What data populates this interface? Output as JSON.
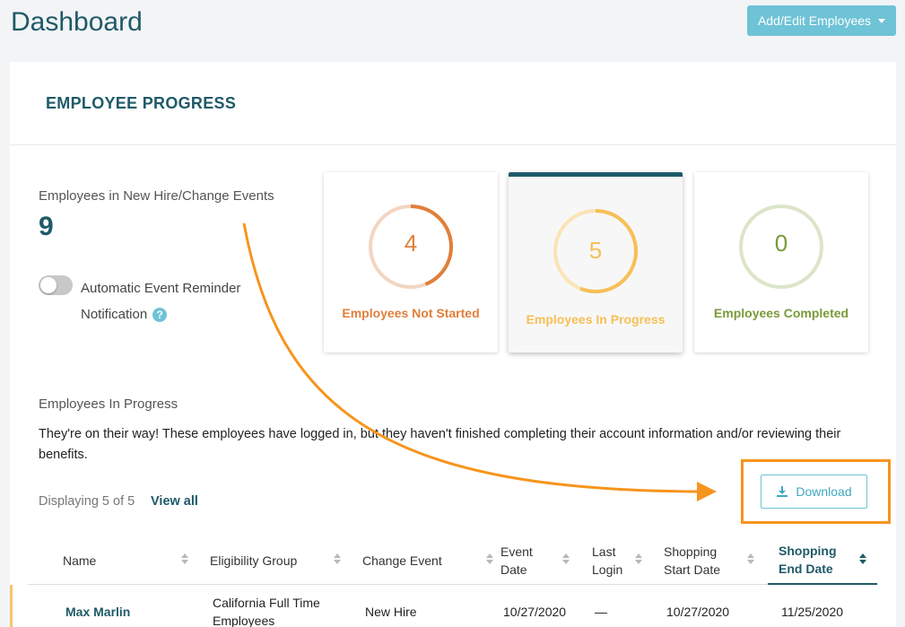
{
  "header": {
    "title": "Dashboard",
    "add_button_label": "Add/Edit Employees"
  },
  "section": {
    "title": "EMPLOYEE PROGRESS"
  },
  "summary": {
    "label": "Employees in New Hire/Change Events",
    "count": "9",
    "toggle_label": "Automatic Event Reminder Notification",
    "toggle_on": false,
    "help_icon": "?"
  },
  "stats": [
    {
      "value": "4",
      "label": "Employees Not Started",
      "color": "#e07f3a",
      "track": "#f2d5c2",
      "progress": 0.44,
      "active": false
    },
    {
      "value": "5",
      "label": "Employees In Progress",
      "color": "#f7bf57",
      "track": "#fbe3b5",
      "progress": 0.56,
      "active": true
    },
    {
      "value": "0",
      "label": "Employees Completed",
      "color": "#7a9a3a",
      "track": "#dbe5c9",
      "progress": 0,
      "active": false
    }
  ],
  "in_progress": {
    "title": "Employees In Progress",
    "description": "They're on their way! These employees have logged in, but they haven't finished completing their account information and/or reviewing their benefits.",
    "displaying": "Displaying 5 of 5",
    "view_all": "View all",
    "download_label": "Download"
  },
  "table": {
    "columns": [
      "Name",
      "Eligibility Group",
      "Change Event",
      "Event Date",
      "Last Login",
      "Shopping Start Date",
      "Shopping End Date"
    ],
    "rows": [
      {
        "name": "Max Marlin",
        "group": "California Full Time Employees",
        "event": "New Hire",
        "event_date": "10/27/2020",
        "last_login": "—",
        "start": "10/27/2020",
        "end": "11/25/2020"
      }
    ]
  },
  "colors": {
    "brand": "#1f5a68",
    "accent": "#6ec3d6",
    "highlight": "#f7941d"
  }
}
